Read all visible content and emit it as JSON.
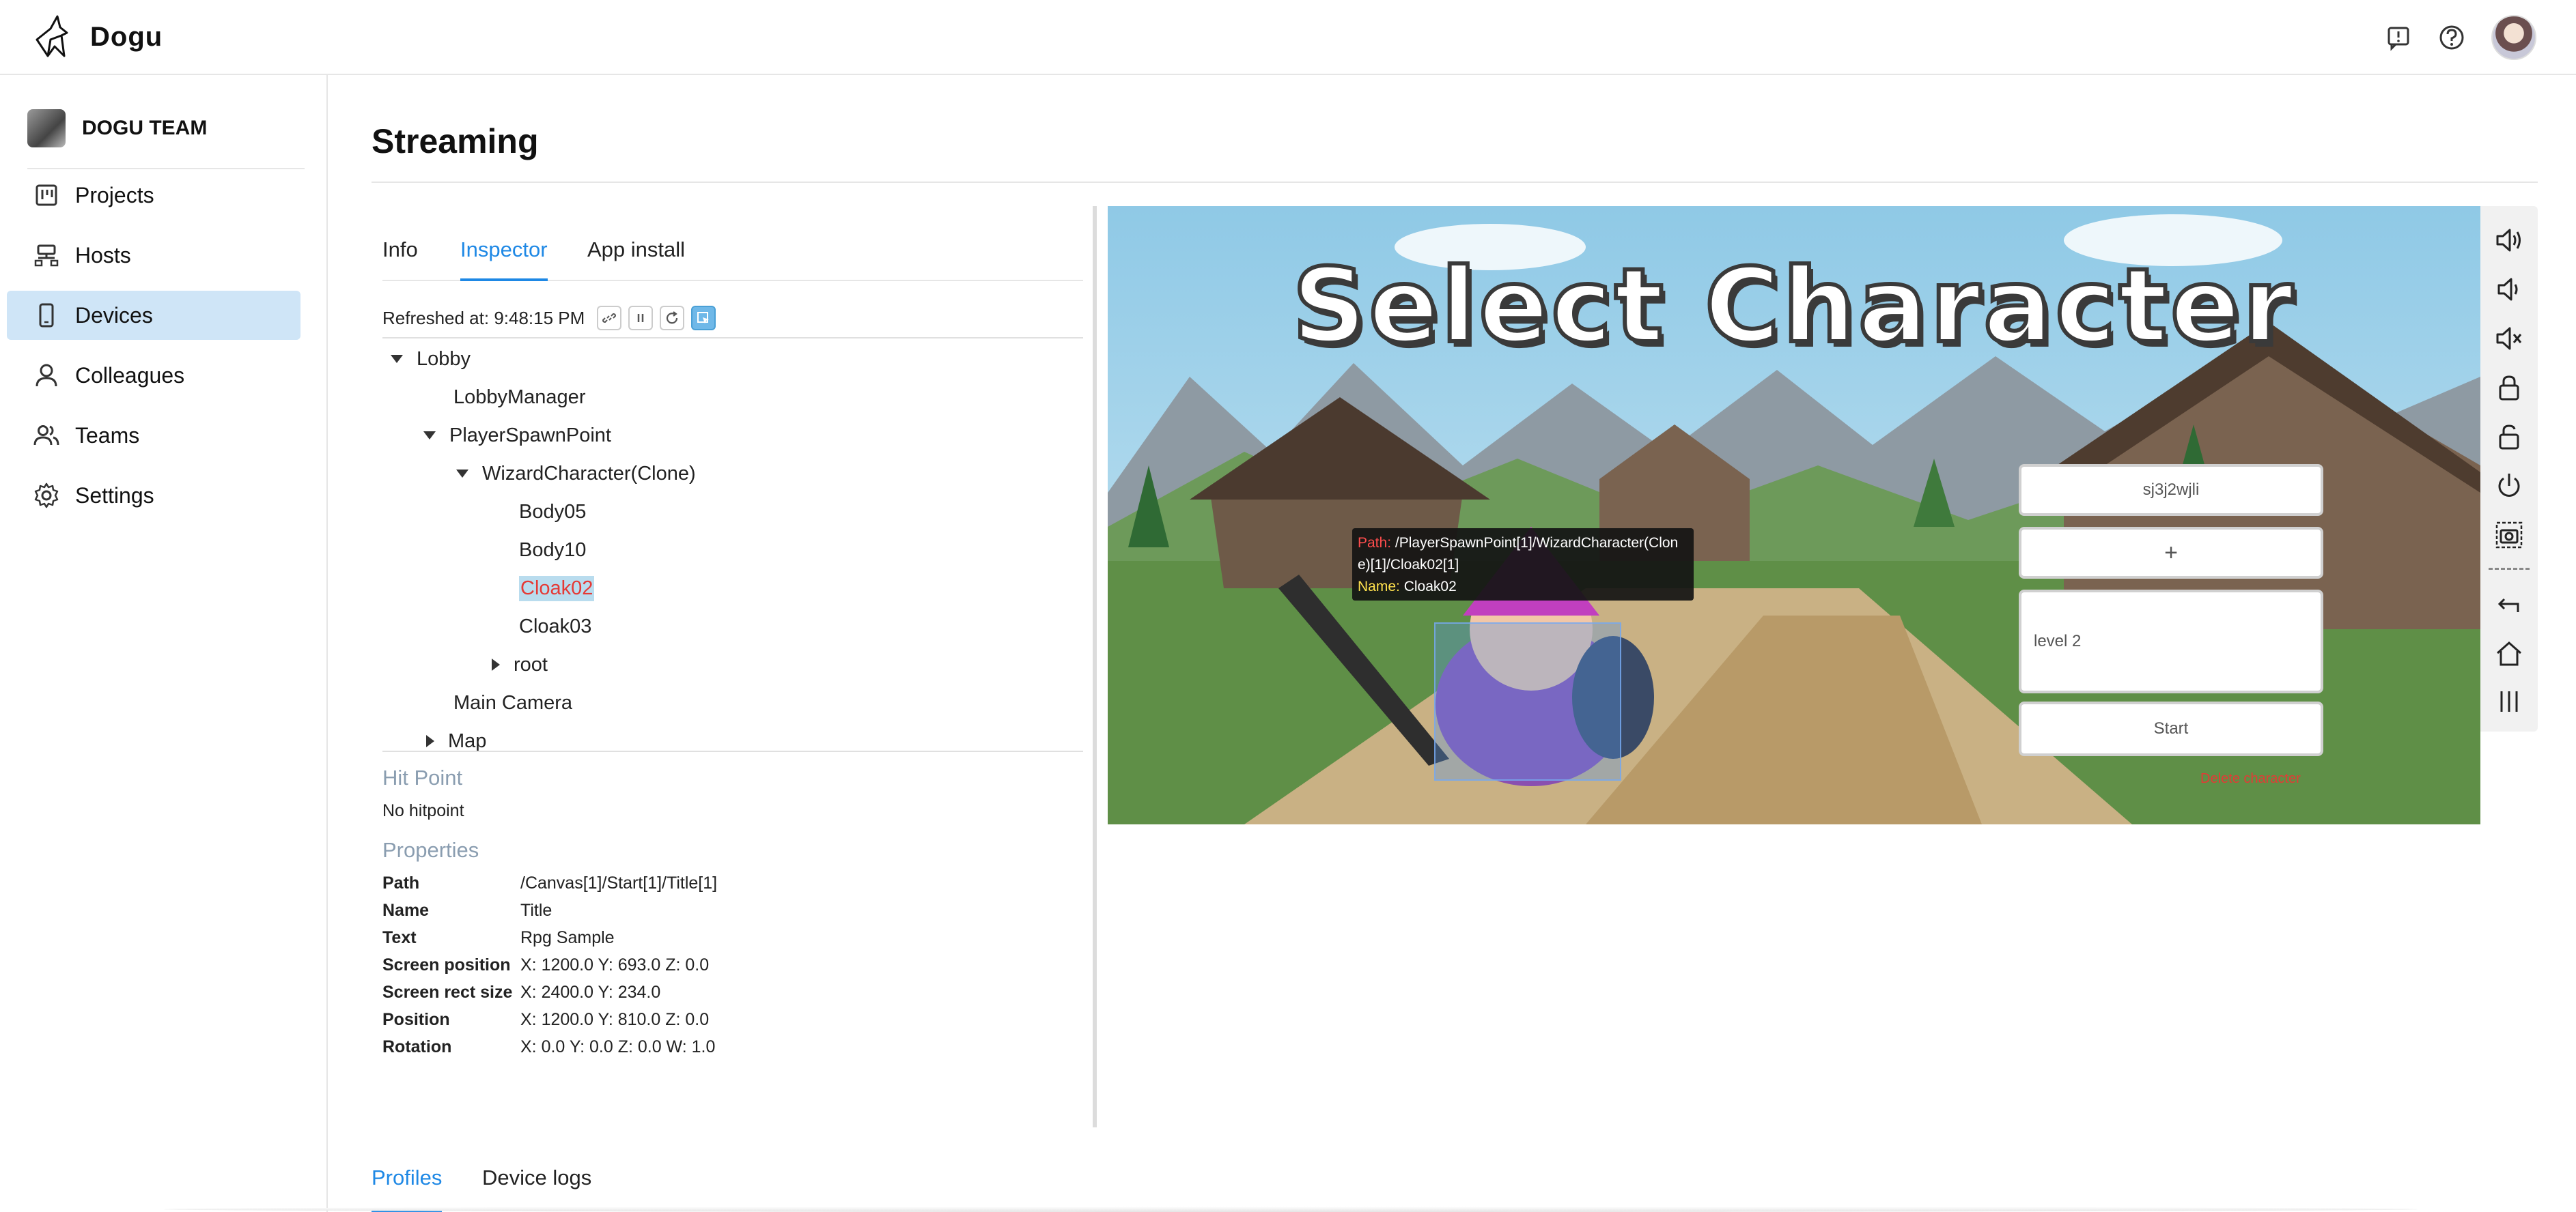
{
  "app": {
    "name": "Dogu"
  },
  "header": {
    "icons": [
      "feedback-icon",
      "help-icon",
      "user-avatar"
    ]
  },
  "sidebar": {
    "org_name": "DOGU TEAM",
    "items": [
      {
        "label": "Projects",
        "icon": "projects-icon"
      },
      {
        "label": "Hosts",
        "icon": "hosts-icon"
      },
      {
        "label": "Devices",
        "icon": "devices-icon",
        "active": true
      },
      {
        "label": "Colleagues",
        "icon": "colleagues-icon"
      },
      {
        "label": "Teams",
        "icon": "teams-icon"
      },
      {
        "label": "Settings",
        "icon": "settings-icon"
      }
    ]
  },
  "main": {
    "title": "Streaming",
    "tabs": [
      {
        "label": "Info"
      },
      {
        "label": "Inspector",
        "active": true
      },
      {
        "label": "App install"
      }
    ],
    "refresh_text": "Refreshed at: 9:48:15 PM",
    "tree": [
      {
        "label": "Lobby",
        "depth": 0,
        "caret": "down"
      },
      {
        "label": "LobbyManager",
        "depth": 1,
        "caret": "none"
      },
      {
        "label": "PlayerSpawnPoint",
        "depth": 1,
        "caret": "down"
      },
      {
        "label": "WizardCharacter(Clone)",
        "depth": 2,
        "caret": "down"
      },
      {
        "label": "Body05",
        "depth": 3,
        "caret": "none"
      },
      {
        "label": "Body10",
        "depth": 3,
        "caret": "none"
      },
      {
        "label": "Cloak02",
        "depth": 3,
        "caret": "none",
        "selected": true
      },
      {
        "label": "Cloak03",
        "depth": 3,
        "caret": "none"
      },
      {
        "label": "root",
        "depth": 3,
        "caret": "right"
      },
      {
        "label": "Main Camera",
        "depth": 1,
        "caret": "none"
      },
      {
        "label": "Map",
        "depth": 1,
        "caret": "right"
      }
    ],
    "hit_point": {
      "title": "Hit Point",
      "value": "No hitpoint"
    },
    "properties": {
      "title": "Properties",
      "rows": [
        {
          "key": "Path",
          "value": "/Canvas[1]/Start[1]/Title[1]"
        },
        {
          "key": "Name",
          "value": "Title"
        },
        {
          "key": "Text",
          "value": "Rpg Sample"
        },
        {
          "key": "Screen position",
          "value": "X: 1200.0  Y: 693.0  Z: 0.0"
        },
        {
          "key": "Screen rect size",
          "value": "X: 2400.0  Y: 234.0"
        },
        {
          "key": "Position",
          "value": "X: 1200.0  Y: 810.0  Z: 0.0"
        },
        {
          "key": "Rotation",
          "value": "X: 0.0  Y: 0.0  Z: 0.0  W: 1.0"
        }
      ]
    }
  },
  "stream": {
    "game_title": "Select Character",
    "name_field": "sj3j2wjli",
    "add_label": "+",
    "level_field": "level 2",
    "start_label": "Start",
    "delete_label": "Delete character",
    "tooltip": {
      "path_key": "Path:",
      "path_line1": "/PlayerSpawnPoint[1]/WizardCharacter(Clon",
      "path_line2": "e)[1]/Cloak02[1]",
      "name_key": "Name:",
      "name_value": "Cloak02"
    }
  },
  "device_controls": [
    "volume-up-icon",
    "volume-down-icon",
    "mute-icon",
    "lock-icon",
    "unlock-icon",
    "power-icon",
    "screenshot-icon",
    "back-icon",
    "home-icon",
    "recent-apps-icon"
  ],
  "bottom_tabs": [
    {
      "label": "Profiles",
      "active": true
    },
    {
      "label": "Device logs"
    }
  ]
}
